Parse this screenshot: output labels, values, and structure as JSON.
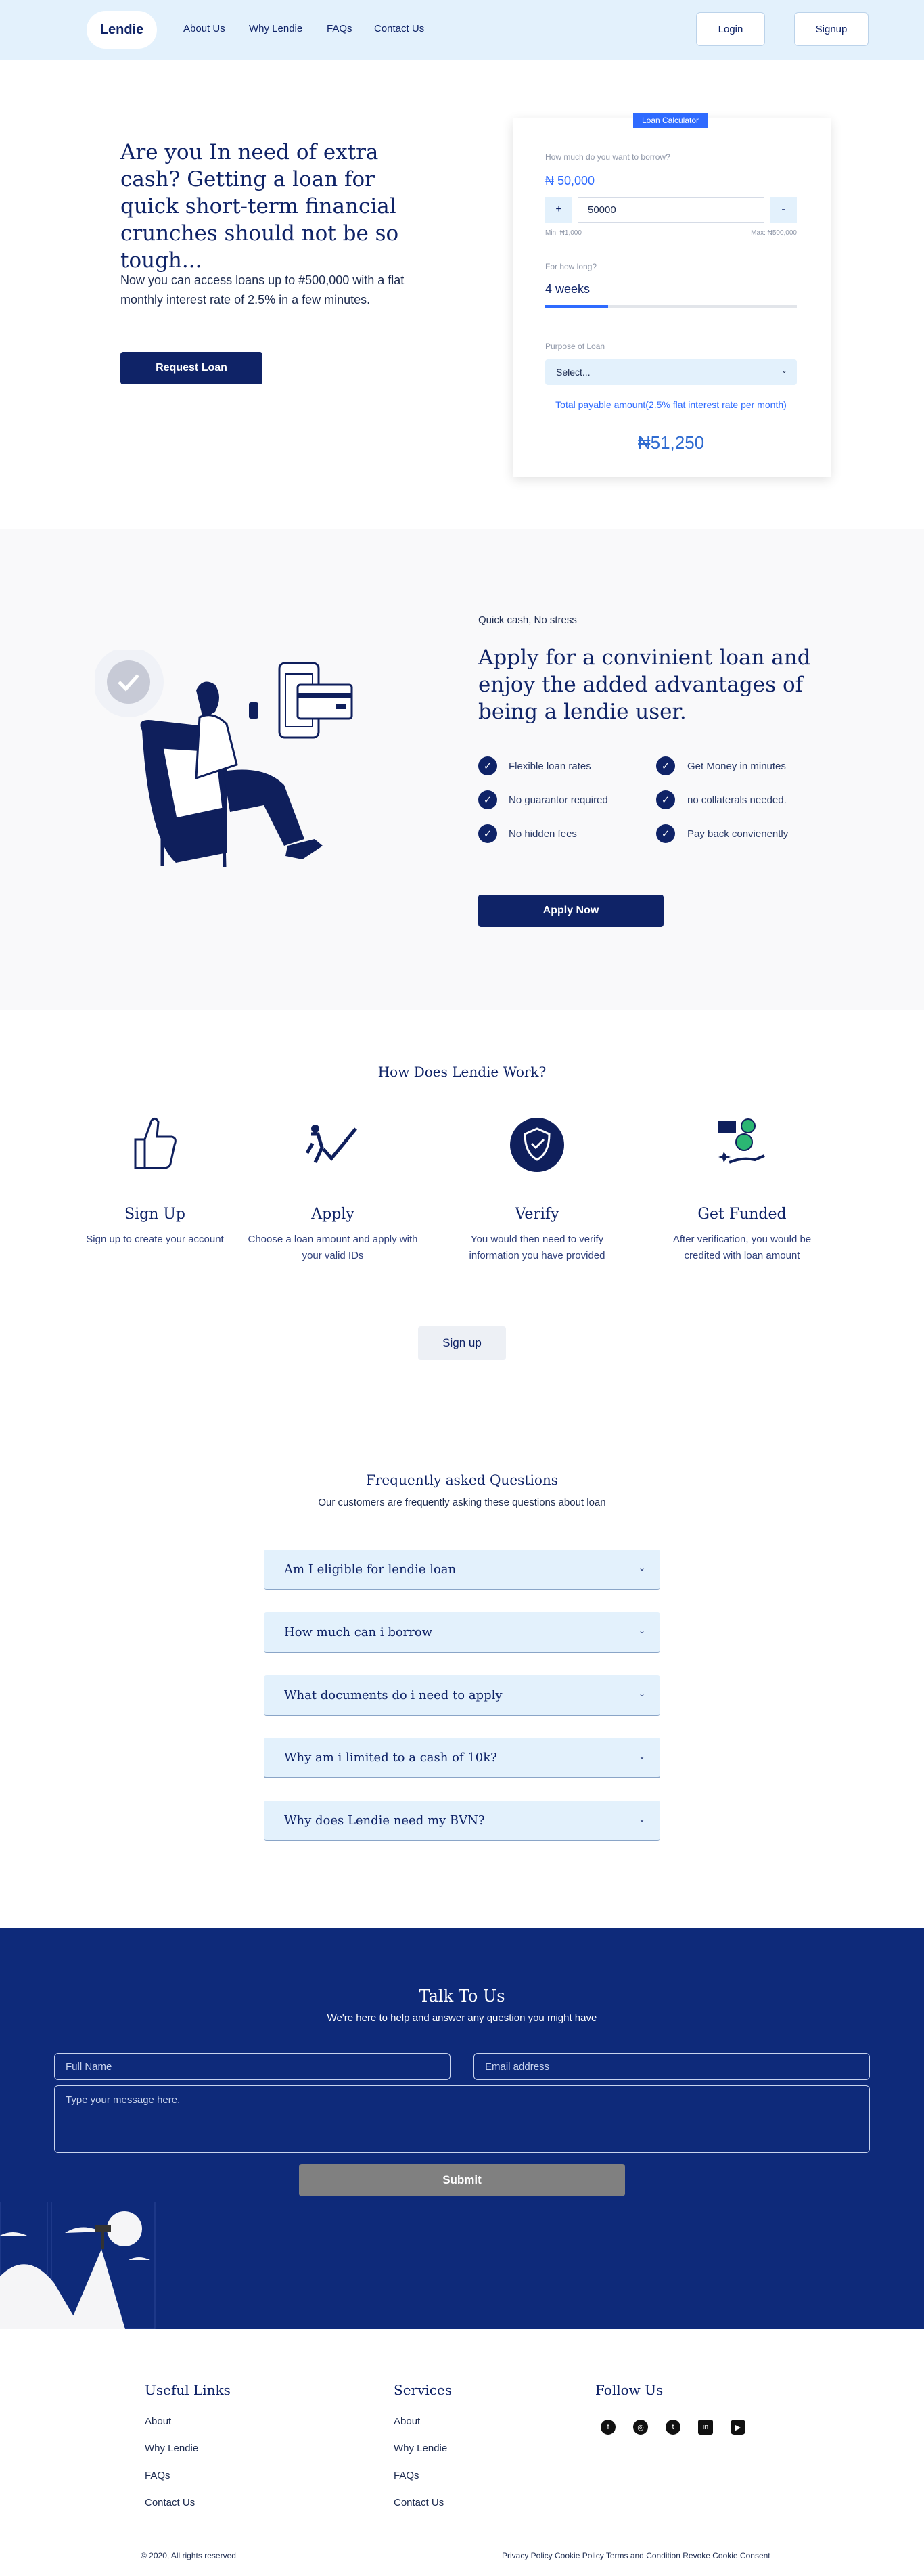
{
  "nav": {
    "logo": "Lendie",
    "links": [
      "About Us",
      "Why Lendie",
      "FAQs",
      "Contact Us"
    ],
    "login": "Login",
    "signup": "Signup"
  },
  "hero": {
    "title": "Are you In need of extra cash? Getting a loan for quick short-term financial crunches should not be so tough...",
    "text": "Now you can access loans up to #500,000 with a flat monthly interest rate of 2.5% in a few minutes.",
    "button": "Request Loan"
  },
  "calculator": {
    "tag": "Loan Calculator",
    "amount_label": "How much do you want to borrow?",
    "amount_display": "₦ 50,000",
    "plus": "+",
    "minus": "-",
    "amount_value": "50000",
    "min": "Min: ₦1,000",
    "max": "Max: ₦500,000",
    "duration_label": "For how long?",
    "duration": "4 weeks",
    "duration_fraction": 0.25,
    "purpose_label": "Purpose of Loan",
    "purpose_value": "Select...",
    "total_label": "Total payable amount(2.5% flat interest rate per month)",
    "total": "₦51,250"
  },
  "advantages": {
    "eyebrow": "Quick cash, No stress",
    "title": "Apply for a convinient loan and enjoy the added advantages of being a lendie user.",
    "items": [
      "Flexible loan rates",
      "Get Money in minutes",
      "No guarantor required",
      "no collaterals needed.",
      "No hidden fees",
      "Pay back convienently"
    ],
    "button": "Apply Now"
  },
  "how": {
    "title": "How Does Lendie Work?",
    "steps": [
      {
        "title": "Sign Up",
        "text": "Sign up to create your account"
      },
      {
        "title": "Apply",
        "text": "Choose a loan amount and apply with your valid IDs"
      },
      {
        "title": "Verify",
        "text": "You would then need to verify information you have provided"
      },
      {
        "title": "Get Funded",
        "text": "After verification, you would be credited with loan amount"
      }
    ],
    "button": "Sign up"
  },
  "faq": {
    "title": "Frequently asked Questions",
    "subtitle": "Our customers are frequently asking these questions about loan",
    "items": [
      "Am I eligible for lendie loan",
      "How much can i borrow",
      "What documents do i need to apply",
      "Why am i limited to a cash of 10k?",
      "Why does Lendie need my BVN?"
    ]
  },
  "contact": {
    "title": "Talk To Us",
    "subtitle": "We're here to help and answer any question you might have",
    "name_placeholder": "Full Name",
    "email_placeholder": "Email address",
    "message_placeholder": "Type your message here.",
    "submit": "Submit"
  },
  "footer": {
    "useful_title": "Useful Links",
    "useful_links": [
      "About",
      "Why Lendie",
      "FAQs",
      "Contact Us"
    ],
    "services_title": "Services",
    "services_links": [
      "About",
      "Why Lendie",
      "FAQs",
      "Contact Us"
    ],
    "follow_title": "Follow Us",
    "socials": [
      "facebook-icon",
      "instagram-icon",
      "twitter-icon",
      "linkedin-icon",
      "youtube-icon"
    ],
    "copyright": "© 2020, All rights reserved",
    "legal": "Privacy Policy Cookie Policy Terms and Condition Revoke Cookie Consent"
  },
  "colors": {
    "navy": "#0f2367",
    "light_blue": "#e3f1fc",
    "contact_bg": "#0e2a7a",
    "accent": "#2f6bff"
  }
}
